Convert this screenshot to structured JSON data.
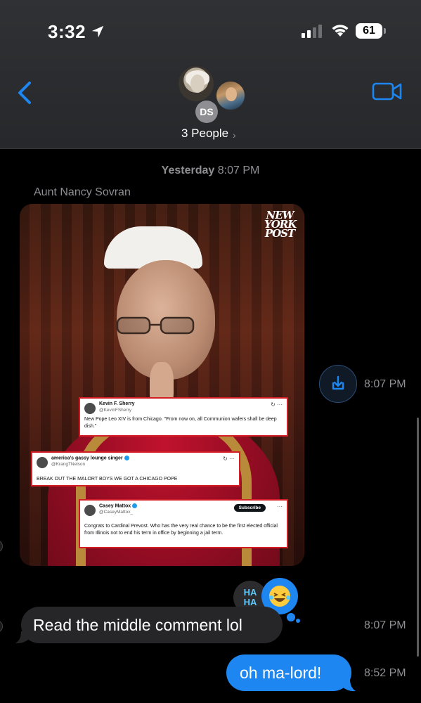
{
  "status_bar": {
    "time": "3:32",
    "battery": "61"
  },
  "header": {
    "group_label": "3 People",
    "chevron": "›",
    "ds_initials": "DS",
    "back_icon": "chevron-left-icon",
    "video_icon": "video-camera-icon"
  },
  "conversation": {
    "timestamp_day": "Yesterday",
    "timestamp_time": "8:07 PM",
    "sender": "Aunt Nancy Sovran",
    "image_message": {
      "brand": "NEW YORK POST",
      "tweets": [
        {
          "name": "Kevin F. Sherry",
          "handle": "@KevinFSherry",
          "body": "New Pope Leo XIV is from Chicago. \"From now on, all Communion wafers shall be deep dish.\""
        },
        {
          "name": "america's gassy lounge singer",
          "handle": "@KrangTNelson",
          "body": "BREAK OUT THE MALORT BOYS WE GOT A CHICAGO POPE"
        },
        {
          "name": "Casey Mattox",
          "handle": "@CaseyMattox_",
          "subscribe": "Subscribe",
          "body": "Congrats to Cardinal Prevost. Who has the very real chance to be the first elected official from Illinois not to end his term in office by beginning a jail term."
        }
      ],
      "time": "8:07 PM"
    },
    "reactions": {
      "haha_text": "HA HA",
      "emoji": "😂"
    },
    "messages": [
      {
        "text": "Read the middle comment lol",
        "time": "8:07 PM",
        "from": "them"
      },
      {
        "text": "oh ma-lord!",
        "time": "8:52 PM",
        "from": "me"
      }
    ]
  },
  "colors": {
    "accent": "#1e86f0",
    "bubble_gray": "#262629",
    "header_bg": "#2f3134",
    "timestamp_gray": "#8e8e93",
    "tweet_border": "#d31e26"
  }
}
